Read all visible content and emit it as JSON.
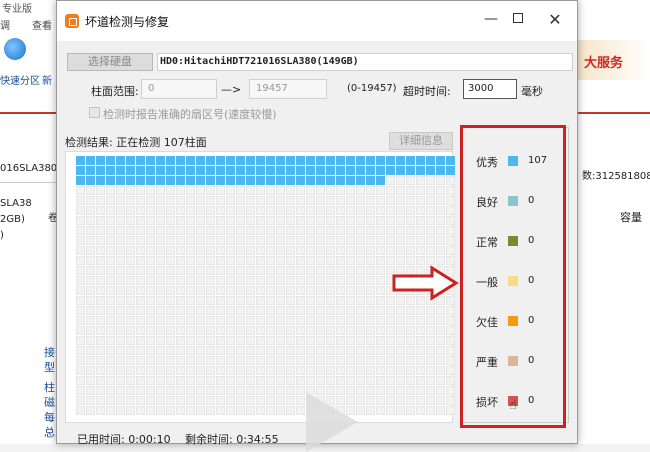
{
  "background": {
    "title": "专业版",
    "menu": [
      "调",
      "查看"
    ],
    "toolbar": [
      "快速分区",
      "新"
    ],
    "disk_row": "016SLA380",
    "disk_tree": [
      "SLA38",
      "2GB)",
      ")"
    ],
    "col_hdr": "卷",
    "left_links": [
      "接",
      "型"
    ],
    "left_links2": [
      "柱",
      "磁",
      "每",
      "总"
    ],
    "ad": "大服务",
    "right_value": "数:312581808",
    "capacity": "容量"
  },
  "dialog": {
    "title": "坏道检测与修复",
    "select_disk": "选择硬盘",
    "disk_name": "HD0:HitachiHDT721016SLA380(149GB)",
    "cylinder_label": "柱面范围:",
    "cylinder_from": "0",
    "arrow": "—>",
    "cylinder_to": "19457",
    "cylinder_range": "(0-19457)",
    "timeout_label": "超时时间:",
    "timeout_value": "3000",
    "timeout_unit": "毫秒",
    "report_check": "检测时报告准确的扇区号(速度较慢)",
    "result_label": "检测结果:  正在检测  107柱面",
    "detail_button": "详细信息",
    "elapsed": "已用时间:    0:00:10",
    "remaining": "剩余时间:    0:34:55"
  },
  "grid": {
    "cols": 38,
    "rows": 26,
    "done": 107,
    "done_color": "#4db8ee",
    "empty_color": "#f2f2f2"
  },
  "legend": [
    {
      "label": "优秀",
      "color": "#4db8ee",
      "count": "107"
    },
    {
      "label": "良好",
      "color": "#8ac6cc",
      "count": "0"
    },
    {
      "label": "正常",
      "color": "#7b8a2e",
      "count": "0"
    },
    {
      "label": "一般",
      "color": "#f4dd82",
      "count": "0"
    },
    {
      "label": "欠佳",
      "color": "#f39c12",
      "count": "0"
    },
    {
      "label": "严重",
      "color": "#dbb79a",
      "count": "0"
    },
    {
      "label": "损坏",
      "color": "#d9534f",
      "count": "0"
    }
  ],
  "accent": "#cc2222"
}
